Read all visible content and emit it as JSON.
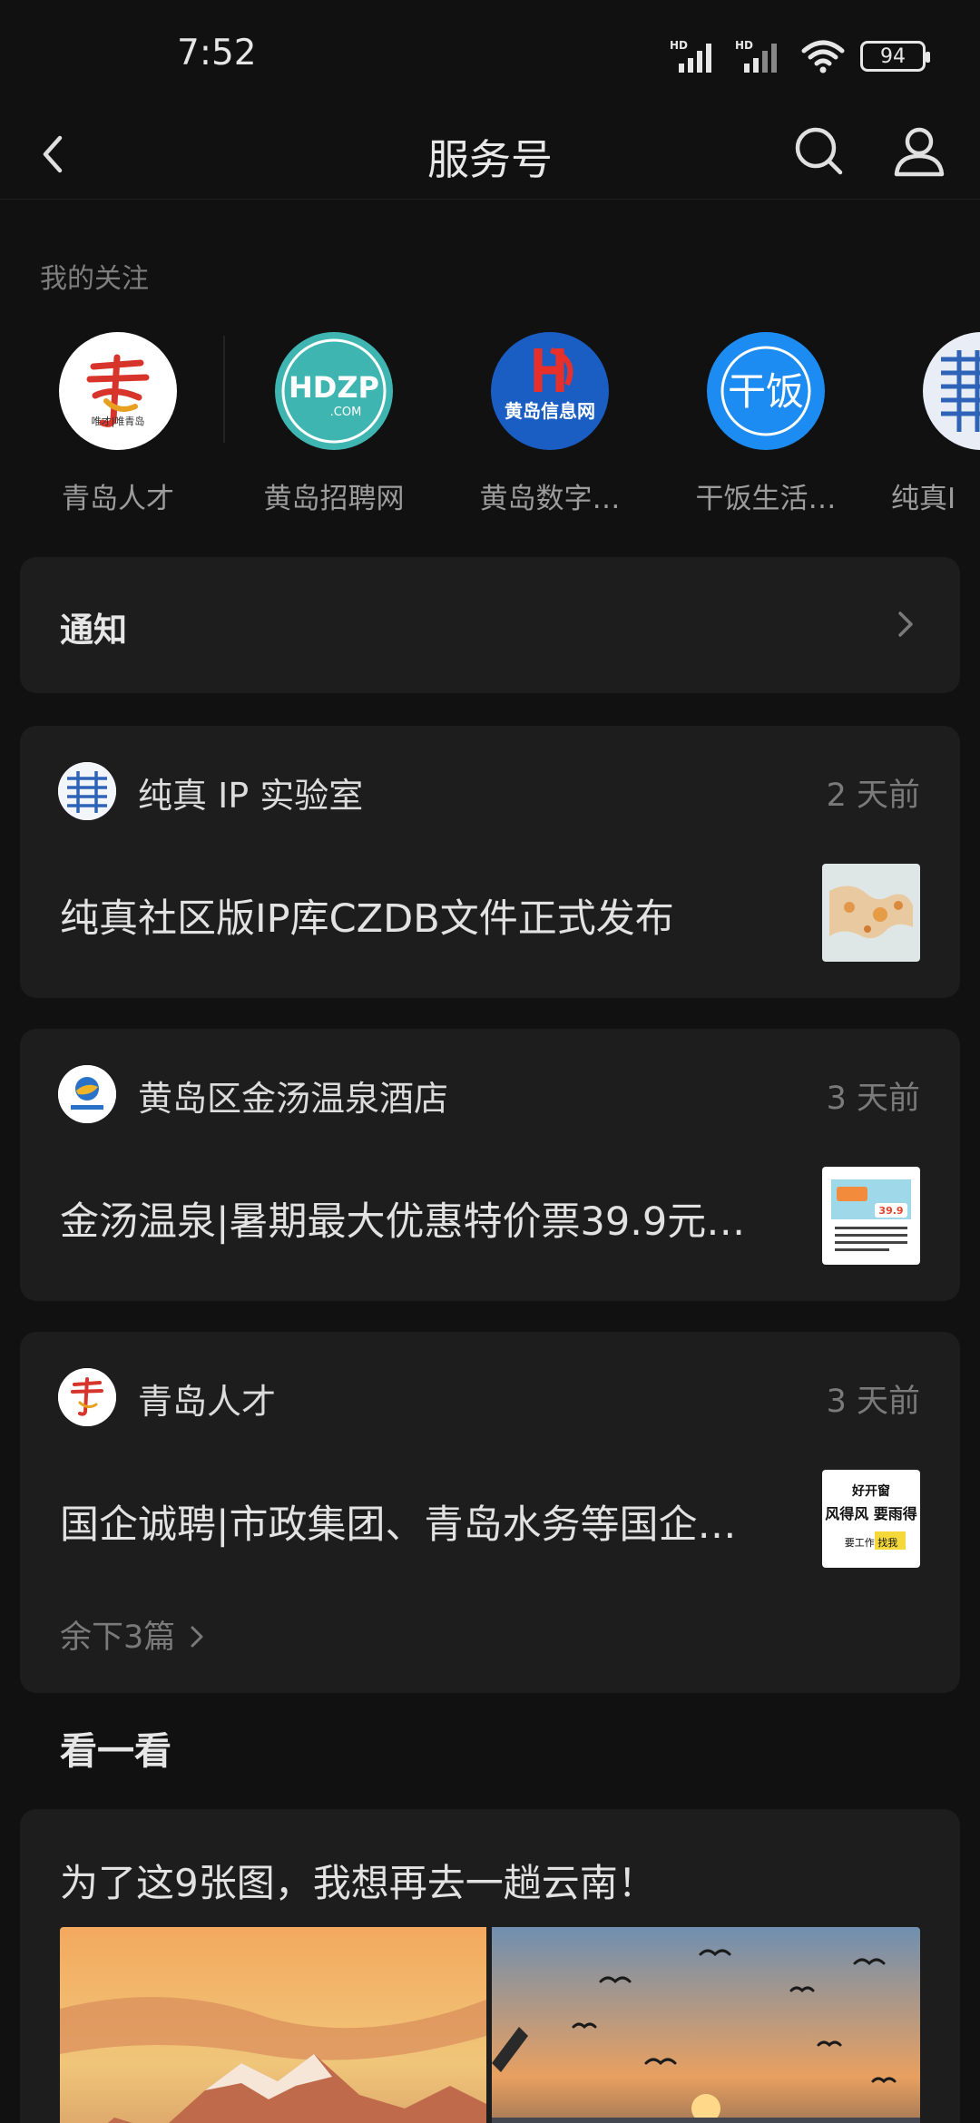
{
  "status_bar": {
    "time": "7:52",
    "battery": "94",
    "network_badge_1": "HD",
    "network_badge_2": "HD"
  },
  "header": {
    "title": "服务号"
  },
  "following": {
    "label": "我的关注",
    "items": [
      {
        "name": "青岛人才",
        "avatar_text": "唯才|唯青岛"
      },
      {
        "name": "黄岛招聘网",
        "avatar_text": "HDZP",
        "avatar_subtext": ".COM"
      },
      {
        "name": "黄岛数字…",
        "avatar_text": "黄岛信息网"
      },
      {
        "name": "干饭生活…",
        "avatar_text": "干饭"
      },
      {
        "name": "纯真I"
      }
    ]
  },
  "notice": {
    "title": "通知"
  },
  "messages": [
    {
      "account": "纯真 IP 实验室",
      "time": "2 天前",
      "title": "纯真社区版IP库CZDB文件正式发布"
    },
    {
      "account": "黄岛区金汤温泉酒店",
      "time": "3 天前",
      "title": "金汤温泉|暑期最大优惠特价票39.9元…",
      "thumb_price": "39.9"
    },
    {
      "account": "青岛人才",
      "time": "3 天前",
      "title": "国企诚聘|市政集团、青岛水务等国企…",
      "more": "余下3篇",
      "thumb_line1": "好开窗",
      "thumb_line2": "风得风 要雨得",
      "thumb_line3": "要工作 找我"
    }
  ],
  "explore": {
    "title": "看一看",
    "article_title": "为了这9张图，我想再去一趟云南！"
  },
  "colors": {
    "background": "#111111",
    "card": "#1d1d1d",
    "text_primary": "#e2e2e2",
    "text_secondary": "#7a7a7a"
  }
}
